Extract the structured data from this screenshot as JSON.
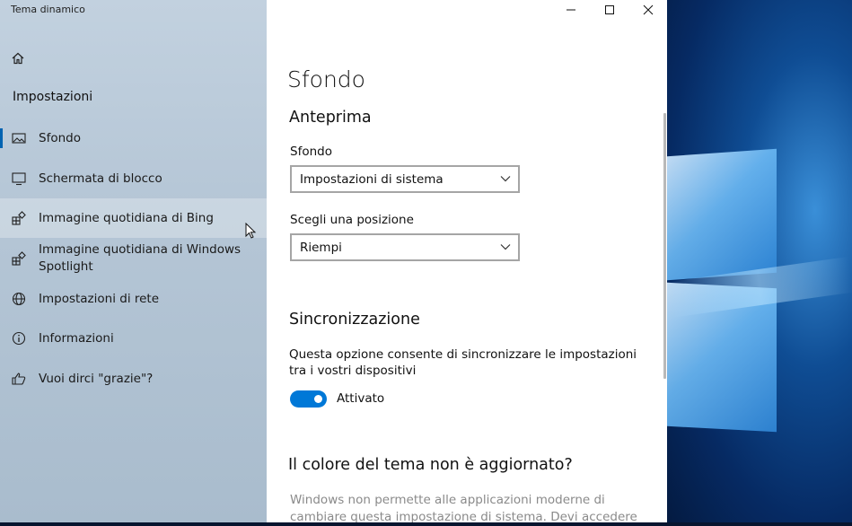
{
  "window": {
    "app_title": "Tema dinamico"
  },
  "nav": {
    "section_title": "Impostazioni",
    "items": [
      {
        "label": "Sfondo",
        "icon": "image-icon",
        "selected": true
      },
      {
        "label": "Schermata di blocco",
        "icon": "monitor-icon"
      },
      {
        "label": "Immagine quotidiana di Bing",
        "icon": "app-grid-icon"
      },
      {
        "label": "Immagine quotidiana di Windows Spotlight",
        "icon": "app-grid-icon"
      },
      {
        "label": "Impostazioni di rete",
        "icon": "globe-icon"
      },
      {
        "label": "Informazioni",
        "icon": "info-icon"
      },
      {
        "label": "Vuoi dirci \"grazie\"?",
        "icon": "thumbs-up-icon"
      }
    ]
  },
  "content": {
    "page_title": "Sfondo",
    "preview_heading": "Anteprima",
    "background_label": "Sfondo",
    "background_value": "Impostazioni di sistema",
    "position_label": "Scegli una posizione",
    "position_value": "Riempi",
    "sync_heading": "Sincronizzazione",
    "sync_desc": "Questa opzione consente di sincronizzare le impostazioni tra i vostri dispositivi",
    "toggle_state": "Attivato",
    "theme_heading": "Il colore del tema non è aggiornato?",
    "theme_desc": "Windows non permette alle applicazioni moderne di cambiare questa impostazione di sistema. Devi accedere alle impostazioni"
  },
  "colors": {
    "accent": "#0078d7",
    "nav_background": "#b9c9d9"
  }
}
